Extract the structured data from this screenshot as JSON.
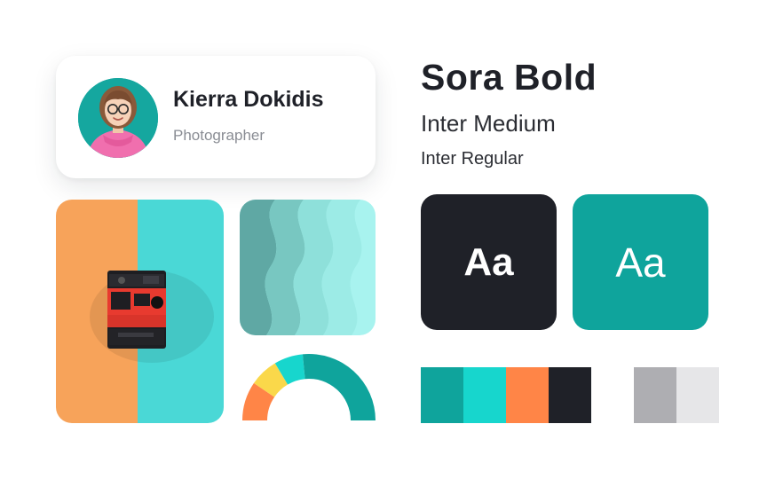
{
  "profile": {
    "name": "Kierra Dokidis",
    "role": "Photographer"
  },
  "typography": {
    "heading": "Sora Bold",
    "medium": "Inter Medium",
    "regular": "Inter Regular",
    "sample_dark": "Aa",
    "sample_teal": "Aa"
  },
  "palette": {
    "primary": [
      "#0fa49c",
      "#17d6cd",
      "#ff8547",
      "#1f2128"
    ],
    "neutral": [
      "#aeaeb2",
      "#e6e6e8"
    ]
  },
  "chart_data": {
    "type": "pie",
    "style": "semi-donut",
    "categories": [
      "orange",
      "yellow",
      "cyan",
      "teal"
    ],
    "values": [
      19,
      14,
      14,
      53
    ],
    "colors": [
      "#ff8547",
      "#fad84a",
      "#17d6cd",
      "#0fa49c"
    ]
  }
}
